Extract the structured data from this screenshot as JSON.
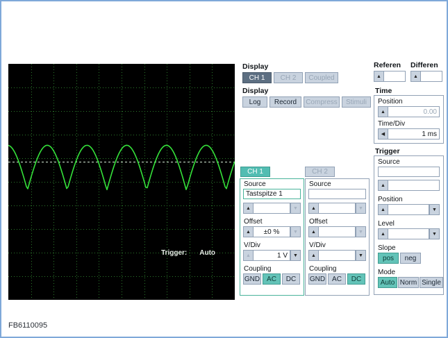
{
  "page": {
    "footer_label": "FB6110095"
  },
  "icons": {
    "up": "▲",
    "down": "▼",
    "left": "◀"
  },
  "scope": {
    "trigger_label": "Trigger:",
    "trigger_value": "Auto",
    "grid_cols": 10,
    "grid_rows": 10,
    "bg": "#000000",
    "grid_color": "#2c7a2c",
    "wave_color": "#35e23a",
    "trigger_line_color": "#d9efd9",
    "trigger_line_frac": 0.415,
    "wave": {
      "cycles": 5.7,
      "phase": 0.52,
      "peak_frac": 0.345,
      "trough_frac": 0.535
    }
  },
  "display_channel": {
    "label": "Display",
    "ch1": "CH 1",
    "ch2": "CH 2",
    "coupled": "Coupled"
  },
  "display_mode": {
    "label": "Display",
    "log": "Log",
    "record": "Record",
    "compress": "Compress",
    "stimuli": "Stimuli"
  },
  "reference": {
    "label": "Referen"
  },
  "difference": {
    "label": "Differen"
  },
  "time": {
    "label": "Time",
    "position_label": "Position",
    "position_value": "0.00",
    "timediv_label": "Time/Div",
    "timediv_value": "1 ms"
  },
  "trigger": {
    "label": "Trigger",
    "source_label": "Source",
    "source_value": "",
    "position_label": "Position",
    "position_value": "",
    "level_label": "Level",
    "level_value": "",
    "slope_label": "Slope",
    "slope_pos": "pos",
    "slope_neg": "neg",
    "mode_label": "Mode",
    "mode_auto": "Auto",
    "mode_norm": "Norm",
    "mode_single": "Single"
  },
  "channels": {
    "ch1_tab": "CH 1",
    "ch2_tab": "CH 2",
    "ch1": {
      "source_label": "Source",
      "source_value": "Tastspitze 1",
      "offset_label": "Offset",
      "offset_value": "±0 %",
      "vdiv_label": "V/Div",
      "vdiv_value": "1 V",
      "coupling_label": "Coupling",
      "gnd": "GND",
      "ac": "AC",
      "dc": "DC"
    },
    "ch2": {
      "source_label": "Source",
      "source_value": "",
      "offset_label": "Offset",
      "offset_value": "",
      "vdiv_label": "V/Div",
      "vdiv_value": "",
      "coupling_label": "Coupling",
      "gnd": "GND",
      "ac": "AC",
      "dc": "DC"
    }
  }
}
